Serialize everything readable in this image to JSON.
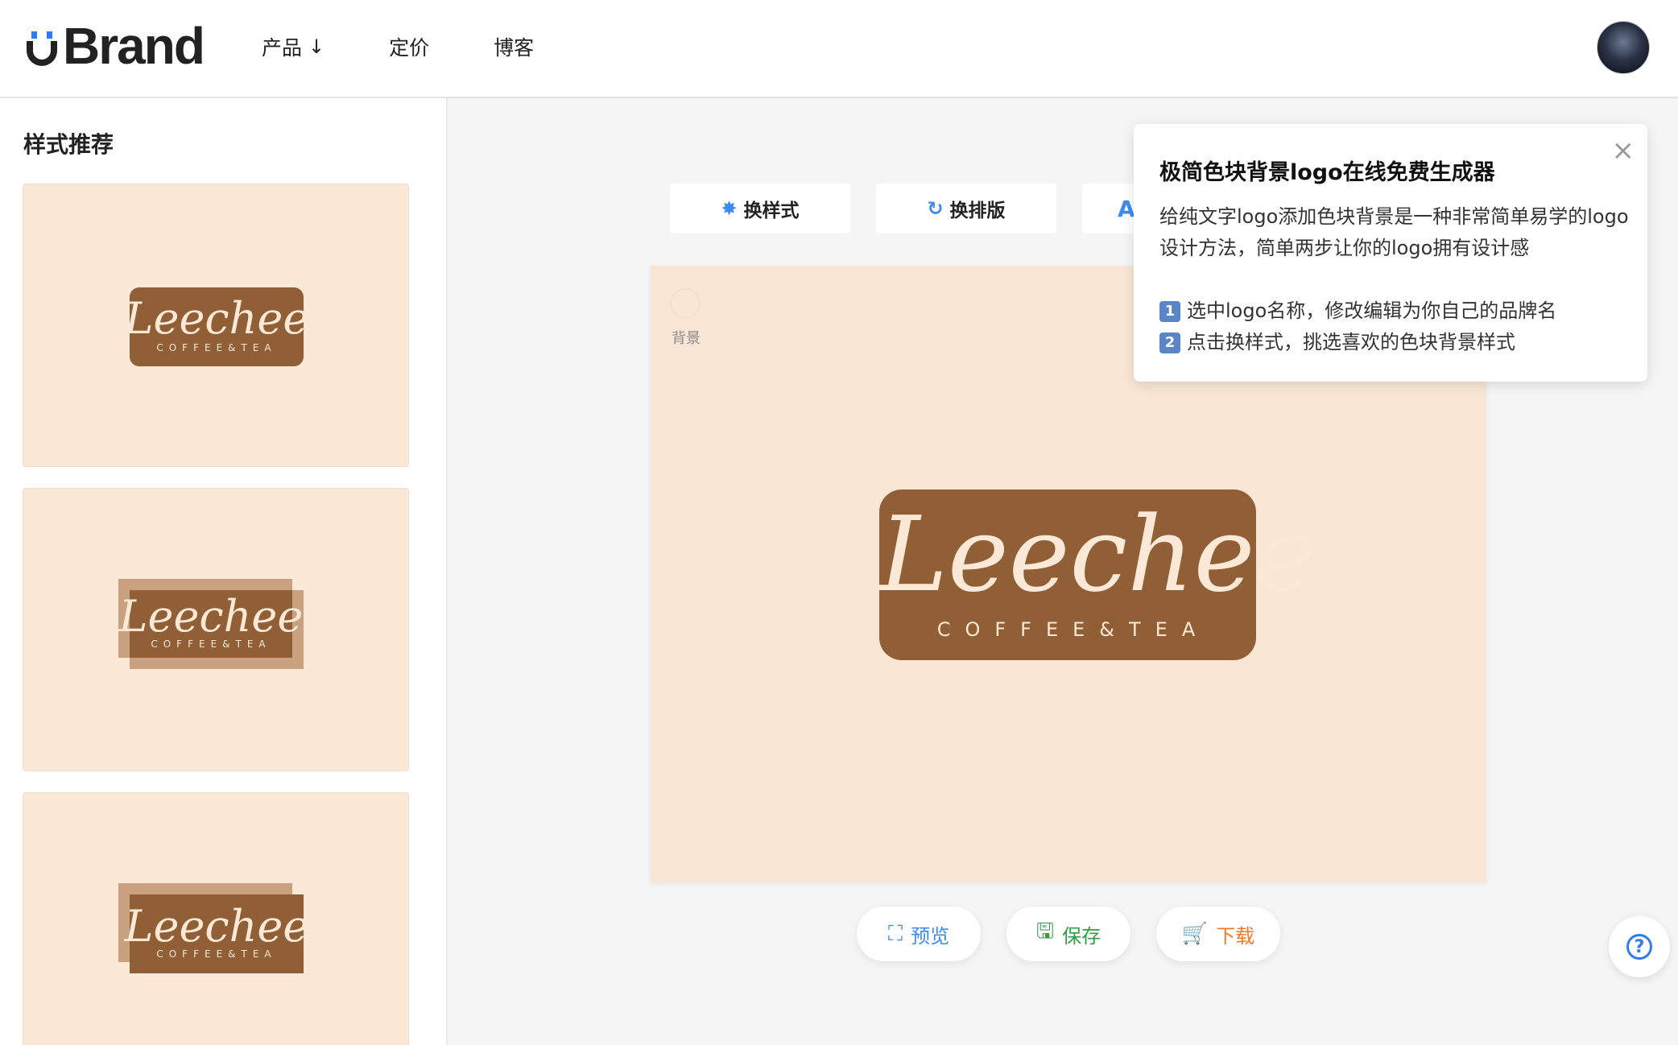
{
  "header": {
    "logo_text": "Brand",
    "nav": [
      {
        "label": "产品",
        "arrow": "↓"
      },
      {
        "label": "定价"
      },
      {
        "label": "博客"
      }
    ]
  },
  "sidebar": {
    "title": "样式推荐",
    "cards": [
      {
        "script": "Leechee",
        "sub": "COFFEE&TEA"
      },
      {
        "script": "Leechee",
        "sub": "COFFEE&TEA"
      },
      {
        "script": "Leechee",
        "sub": "COFFEE&TEA"
      }
    ]
  },
  "toolbar": {
    "change_style": "换样式",
    "change_layout": "换排版",
    "third_icon": "A"
  },
  "canvas": {
    "bg_label": "背景",
    "logo_script": "Leechee",
    "logo_sub": "COFFEE&TEA",
    "bg_color": "#fae6d4",
    "block_color": "#915f36"
  },
  "actions": {
    "preview": "预览",
    "save": "保存",
    "download": "下载"
  },
  "tooltip": {
    "title": "极简色块背景logo在线免费生成器",
    "desc": "给纯文字logo添加色块背景是一种非常简单易学的logo设计方法，简单两步让你的logo拥有设计感",
    "step1_num": "1",
    "step1": "选中logo名称，修改编辑为你自己的品牌名",
    "step2_num": "2",
    "step2": "点击换样式，挑选喜欢的色块背景样式",
    "close": "×"
  },
  "help": {
    "symbol": "?"
  }
}
